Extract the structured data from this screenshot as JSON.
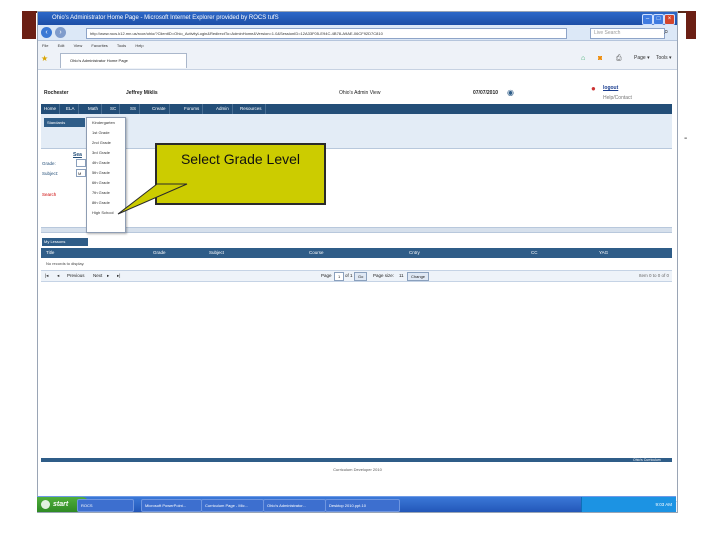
{
  "window": {
    "title": "Ohio's Administrator Home Page - Microsoft Internet Explorer provided by ROCS tufS",
    "address": "http://www.rocs.k12.mn.us/rcoe/ohio/?ClientID=Ohio_ActivityLogin&RedirectTo=AdminHome&Version=1.0&SessionID=12A33F05-E94C-4B78-A9AE-06CF92D7C810",
    "search_placeholder": "Live Search",
    "tab_label": "Ohio's Administrator Home Page"
  },
  "menubar": [
    "File",
    "Edit",
    "View",
    "Favorites",
    "Tools",
    "Help"
  ],
  "header": {
    "school": "Rochester",
    "user": "Jeffrey Miklis",
    "view": "Ohio's Admin View",
    "date": "07/07/2010",
    "logout": "logout",
    "help": "Help/Contact"
  },
  "nav": [
    "Home",
    "ELA",
    "Math",
    "SC",
    "SS",
    "Create",
    "Forums",
    "Admin",
    "Resources"
  ],
  "subpanel": {
    "tab": "Standards",
    "section": "Sea",
    "grade_label": "Grade:",
    "subject_label": "Subject:",
    "subject_value": "M",
    "search_link": "Search"
  },
  "grade_options": [
    "Kindergarten",
    "1st Grade",
    "2nd Grade",
    "3rd Grade",
    "4th Grade",
    "5th Grade",
    "6th Grade",
    "7th Grade",
    "8th Grade",
    "High School"
  ],
  "callout": "Select Grade Level",
  "lessons_tab": "My Lessons",
  "grid": {
    "columns": [
      "Title",
      "Grade",
      "Subject",
      "Course",
      "Cntry",
      "CC",
      "YAG"
    ],
    "empty": "No records to display.",
    "pager": {
      "prev": "Previous",
      "next": "Next",
      "page_label": "Page",
      "page_value": "1",
      "of": "of 1",
      "go": "Go",
      "page_size_label": "Page size:",
      "page_size": "11",
      "change": "Change",
      "summary": "Item 0 to 0 of 0"
    }
  },
  "footer": {
    "copyright": "Curriculum Developer 2010",
    "brand": "Ohio's Curriculum"
  },
  "taskbar": {
    "start": "start",
    "tasks": [
      "ROCS",
      "Microsoft PowerPoint...",
      "Curriculum Page - Mic...",
      "Ohio's Administrator...",
      "Desktop 2010.ppt.10"
    ],
    "clock": "9:03 AM"
  },
  "colors": {
    "nav": "#234e78",
    "callout": "#cccc00",
    "slide_accent": "#6b1f14"
  }
}
